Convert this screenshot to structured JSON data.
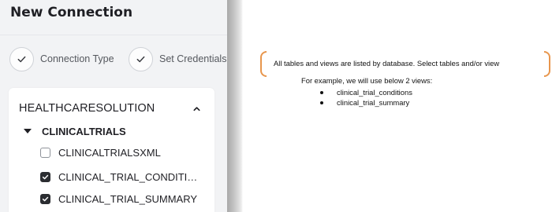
{
  "panel": {
    "title": "New Connection",
    "steps": [
      {
        "label": "Connection Type",
        "completed": true
      },
      {
        "label": "Set Credentials",
        "completed": true
      }
    ],
    "tree": {
      "database": "HEALTHCARESOLUTION",
      "schema": "CLINICALTRIALS",
      "items": [
        {
          "label": "CLINICALTRIALSXML",
          "checked": false
        },
        {
          "label": "CLINICAL_TRIAL_CONDITIONS",
          "checked": true
        },
        {
          "label": "CLINICAL_TRIAL_SUMMARY",
          "checked": true
        }
      ]
    }
  },
  "note": {
    "callout": "All tables and views are listed by database. Select tables and/or view",
    "intro": "For example, we will use below 2 views:",
    "bullets": [
      "clinical_trial_conditions",
      "clinical_trial_summary"
    ]
  },
  "colors": {
    "accent_bracket": "#e8964d",
    "checkbox_checked": "#2b2d31",
    "panel_bg": "#f2f3f5"
  }
}
